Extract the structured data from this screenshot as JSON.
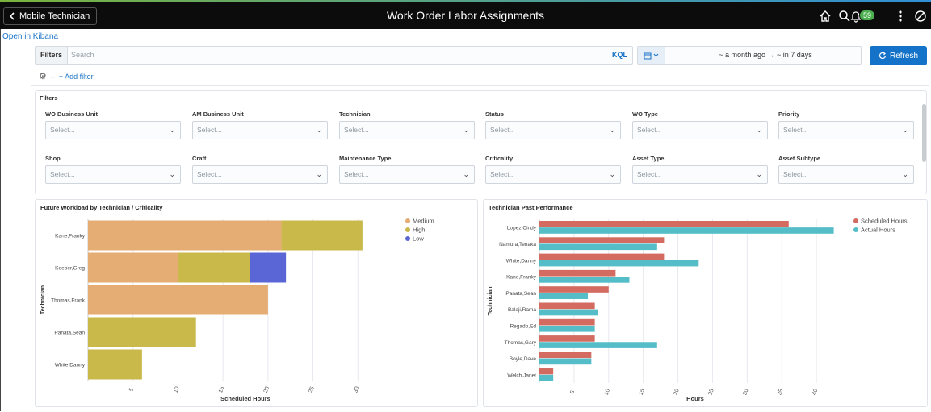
{
  "header": {
    "back_label": "Mobile Technician",
    "title": "Work Order Labor Assignments",
    "notification_count": "59"
  },
  "links": {
    "open_kibana": "Open in Kibana"
  },
  "query": {
    "filters_label": "Filters",
    "search_placeholder": "Search",
    "kql_label": "KQL",
    "date_range": "~ a month ago  →  ~ in 7 days",
    "refresh_label": "Refresh",
    "add_filter_label": "+ Add filter"
  },
  "filters_panel": {
    "title": "Filters",
    "fields": [
      {
        "label": "WO Business Unit",
        "value": "Select..."
      },
      {
        "label": "AM Business Unit",
        "value": "Select..."
      },
      {
        "label": "Technician",
        "value": "Select..."
      },
      {
        "label": "Status",
        "value": "Select..."
      },
      {
        "label": "WO Type",
        "value": "Select..."
      },
      {
        "label": "Priority",
        "value": "Select..."
      },
      {
        "label": "Shop",
        "value": "Select..."
      },
      {
        "label": "Craft",
        "value": "Select..."
      },
      {
        "label": "Maintenance Type",
        "value": "Select..."
      },
      {
        "label": "Criticality",
        "value": "Select..."
      },
      {
        "label": "Asset Type",
        "value": "Select..."
      },
      {
        "label": "Asset Subtype",
        "value": "Select..."
      }
    ]
  },
  "chart_data": [
    {
      "type": "bar",
      "orientation": "horizontal",
      "stacked": true,
      "title": "Future Workload by Technician / Criticality",
      "xlabel": "Scheduled Hours",
      "ylabel": "Technician",
      "xlim": [
        0,
        35
      ],
      "x_ticks": [
        5,
        10,
        15,
        20,
        25,
        30
      ],
      "legend_position": "top-right",
      "categories": [
        "Kane,Franky",
        "Keeper,Greg",
        "Thomas,Frank",
        "Panata,Sean",
        "White,Danny"
      ],
      "series": [
        {
          "name": "Medium",
          "color": "#e5ac73",
          "values": [
            21.5,
            10,
            20,
            0,
            0
          ]
        },
        {
          "name": "High",
          "color": "#c9b84a",
          "values": [
            9,
            8,
            0,
            12,
            6
          ]
        },
        {
          "name": "Low",
          "color": "#5a66d6",
          "values": [
            0,
            4,
            0,
            0,
            0
          ]
        }
      ]
    },
    {
      "type": "bar",
      "orientation": "horizontal",
      "title": "Technician Past Performance",
      "xlabel": "Hours",
      "ylabel": "Technician",
      "xlim": [
        0,
        45
      ],
      "x_ticks": [
        5,
        10,
        15,
        20,
        25,
        30,
        35,
        40
      ],
      "legend_position": "top-right",
      "categories": [
        "Lopez,Cindy",
        "Namura,Tenaka",
        "White,Danny",
        "Kane,Franky",
        "Panata,Sean",
        "Balaji,Rama",
        "Regado,Ed",
        "Thomas,Gary",
        "Boyle,Dave",
        "Welch,Janet"
      ],
      "series": [
        {
          "name": "Scheduled Hours",
          "color": "#d36b60",
          "values": [
            36,
            18,
            18,
            11,
            10,
            8,
            8,
            8,
            7.5,
            2
          ]
        },
        {
          "name": "Actual Hours",
          "color": "#54bdc7",
          "values": [
            42.5,
            17,
            23,
            13,
            7,
            8.5,
            8,
            17,
            7.5,
            2
          ]
        }
      ]
    }
  ]
}
